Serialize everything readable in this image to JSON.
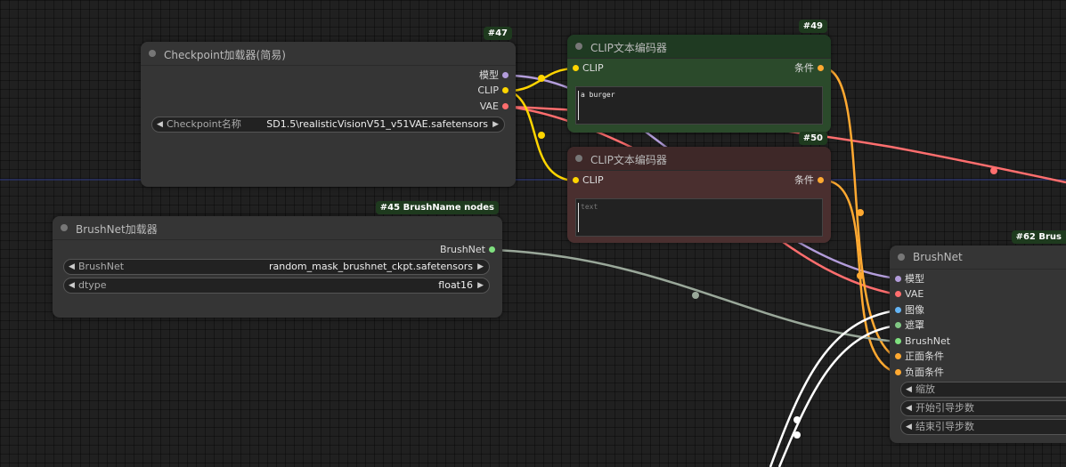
{
  "colors": {
    "model": "#b39ddb",
    "clip": "#ffd500",
    "vae": "#ff6e6e",
    "conditioning": "#ffa931",
    "image": "#64b5f6",
    "mask": "#81c784",
    "brushnet": "#7fe07f",
    "green_node": "#2b4a2b",
    "red_node": "#4a2f2f"
  },
  "checkpoint_node": {
    "badge": "#47",
    "title": "Checkpoint加载器(简易)",
    "outputs": [
      "模型",
      "CLIP",
      "VAE"
    ],
    "widget_label": "Checkpoint名称",
    "widget_value": "SD1.5\\realisticVisionV51_v51VAE.safetensors"
  },
  "clip_pos_node": {
    "badge": "#49",
    "title": "CLIP文本编码器",
    "input": "CLIP",
    "output": "条件",
    "text": "a burger"
  },
  "clip_neg_node": {
    "badge": "#50",
    "title": "CLIP文本编码器",
    "input": "CLIP",
    "output": "条件",
    "placeholder": "text"
  },
  "brushnet_loader_node": {
    "badge": "#45 BrushName nodes",
    "title": "BrushNet加载器",
    "output": "BrushNet",
    "widgets": [
      {
        "label": "BrushNet",
        "value": "random_mask_brushnet_ckpt.safetensors"
      },
      {
        "label": "dtype",
        "value": "float16"
      }
    ]
  },
  "brushnet_node": {
    "badge": "#62 Brus",
    "title": "BrushNet",
    "inputs": [
      "模型",
      "VAE",
      "图像",
      "遮罩",
      "BrushNet",
      "正面条件",
      "负面条件"
    ],
    "widgets": [
      "缩放",
      "开始引导步数",
      "结束引导步数"
    ]
  },
  "icons": {
    "arrow_left": "◀",
    "arrow_right": "▶"
  }
}
